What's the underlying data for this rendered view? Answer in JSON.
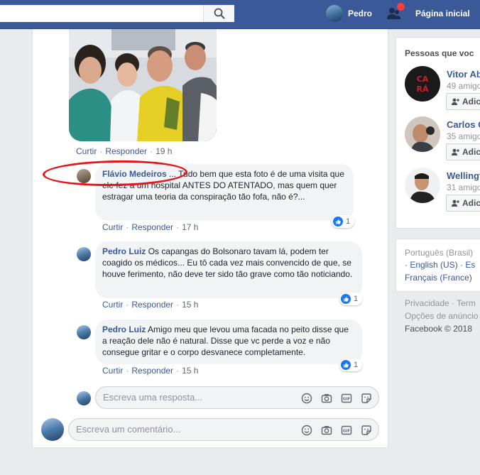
{
  "topbar": {
    "user_name": "Pedro",
    "home_label": "Página inicial"
  },
  "post": {
    "photo_actions": {
      "like": "Curtir",
      "reply": "Responder",
      "time": "19 h"
    }
  },
  "comments": [
    {
      "author": "Flávio Medeiros",
      "text": "... Tudo bem que esta foto é de uma visita que ele fez a um hospital ANTES DO ATENTADO, mas quem quer estragar uma teoria da conspiração tão fofa, não é?...",
      "like": "Curtir",
      "reply": "Responder",
      "time": "17 h",
      "reactions": "1"
    },
    {
      "author": "Pedro Luiz",
      "text": "Os capangas do Bolsonaro tavam lá, podem ter coagido os médicos... Eu tô cada vez mais convencido de que, se houve ferimento, não deve ter sido tão grave como tão noticiando.",
      "like": "Curtir",
      "reply": "Responder",
      "time": "15 h",
      "reactions": "1"
    },
    {
      "author": "Pedro Luiz",
      "text": "Amigo meu que levou uma facada no peito disse que a reação dele não é natural. Disse que vc perde a voz e não consegue gritar e o corpo desvanece completamente.",
      "like": "Curtir",
      "reply": "Responder",
      "time": "15 h",
      "reactions": "1"
    }
  ],
  "reply_input": {
    "placeholder": "Escreva uma resposta..."
  },
  "comment_input": {
    "placeholder": "Escreva um comentário..."
  },
  "sidebar": {
    "people_title": "Pessoas que voc",
    "people": [
      {
        "name": "Vitor Ab",
        "mutual": "49 amigo",
        "add": "Adic"
      },
      {
        "name": "Carlos C",
        "mutual": "35 amigo",
        "add": "Adic"
      },
      {
        "name": "Wellingt",
        "mutual": "31 amigo",
        "add": "Adic"
      }
    ],
    "languages": {
      "line1": "Português (Brasil)",
      "line2_a": "· English (US)",
      "line2_b": "· Es",
      "line3": "Français (France)"
    },
    "footer": {
      "line1": "Privacidade · Term",
      "line2": "Opções de anúncio",
      "line3": "Facebook © 2018"
    }
  },
  "colors": {
    "brand": "#3b5998",
    "link": "#385898",
    "like_blue": "#1877f2",
    "annotation_red": "#e3161a"
  }
}
